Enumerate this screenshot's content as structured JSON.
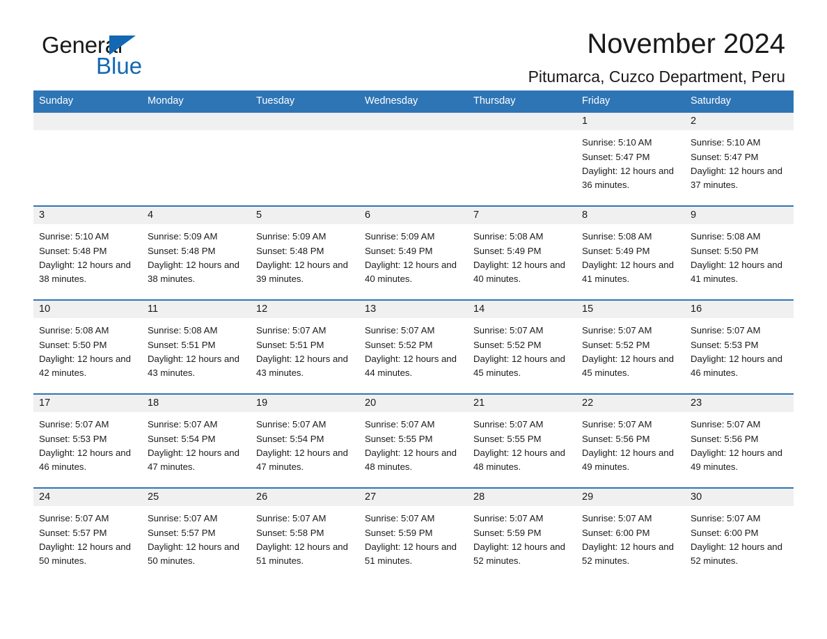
{
  "brand": {
    "name_part1": "General",
    "name_part2": "Blue",
    "accent_color": "#1268b3"
  },
  "header": {
    "title": "November 2024",
    "subtitle": "Pitumarca, Cuzco Department, Peru"
  },
  "calendar": {
    "header_bg": "#2e75b6",
    "daynum_bg": "#f0f0f0",
    "weekday_names": [
      "Sunday",
      "Monday",
      "Tuesday",
      "Wednesday",
      "Thursday",
      "Friday",
      "Saturday"
    ],
    "labels": {
      "sunrise": "Sunrise:",
      "sunset": "Sunset:",
      "daylight": "Daylight:"
    },
    "weeks": [
      [
        {
          "day": "",
          "empty": true
        },
        {
          "day": "",
          "empty": true
        },
        {
          "day": "",
          "empty": true
        },
        {
          "day": "",
          "empty": true
        },
        {
          "day": "",
          "empty": true
        },
        {
          "day": "1",
          "sunrise": "Sunrise: 5:10 AM",
          "sunset": "Sunset: 5:47 PM",
          "daylight": "Daylight: 12 hours and 36 minutes."
        },
        {
          "day": "2",
          "sunrise": "Sunrise: 5:10 AM",
          "sunset": "Sunset: 5:47 PM",
          "daylight": "Daylight: 12 hours and 37 minutes."
        }
      ],
      [
        {
          "day": "3",
          "sunrise": "Sunrise: 5:10 AM",
          "sunset": "Sunset: 5:48 PM",
          "daylight": "Daylight: 12 hours and 38 minutes."
        },
        {
          "day": "4",
          "sunrise": "Sunrise: 5:09 AM",
          "sunset": "Sunset: 5:48 PM",
          "daylight": "Daylight: 12 hours and 38 minutes."
        },
        {
          "day": "5",
          "sunrise": "Sunrise: 5:09 AM",
          "sunset": "Sunset: 5:48 PM",
          "daylight": "Daylight: 12 hours and 39 minutes."
        },
        {
          "day": "6",
          "sunrise": "Sunrise: 5:09 AM",
          "sunset": "Sunset: 5:49 PM",
          "daylight": "Daylight: 12 hours and 40 minutes."
        },
        {
          "day": "7",
          "sunrise": "Sunrise: 5:08 AM",
          "sunset": "Sunset: 5:49 PM",
          "daylight": "Daylight: 12 hours and 40 minutes."
        },
        {
          "day": "8",
          "sunrise": "Sunrise: 5:08 AM",
          "sunset": "Sunset: 5:49 PM",
          "daylight": "Daylight: 12 hours and 41 minutes."
        },
        {
          "day": "9",
          "sunrise": "Sunrise: 5:08 AM",
          "sunset": "Sunset: 5:50 PM",
          "daylight": "Daylight: 12 hours and 41 minutes."
        }
      ],
      [
        {
          "day": "10",
          "sunrise": "Sunrise: 5:08 AM",
          "sunset": "Sunset: 5:50 PM",
          "daylight": "Daylight: 12 hours and 42 minutes."
        },
        {
          "day": "11",
          "sunrise": "Sunrise: 5:08 AM",
          "sunset": "Sunset: 5:51 PM",
          "daylight": "Daylight: 12 hours and 43 minutes."
        },
        {
          "day": "12",
          "sunrise": "Sunrise: 5:07 AM",
          "sunset": "Sunset: 5:51 PM",
          "daylight": "Daylight: 12 hours and 43 minutes."
        },
        {
          "day": "13",
          "sunrise": "Sunrise: 5:07 AM",
          "sunset": "Sunset: 5:52 PM",
          "daylight": "Daylight: 12 hours and 44 minutes."
        },
        {
          "day": "14",
          "sunrise": "Sunrise: 5:07 AM",
          "sunset": "Sunset: 5:52 PM",
          "daylight": "Daylight: 12 hours and 45 minutes."
        },
        {
          "day": "15",
          "sunrise": "Sunrise: 5:07 AM",
          "sunset": "Sunset: 5:52 PM",
          "daylight": "Daylight: 12 hours and 45 minutes."
        },
        {
          "day": "16",
          "sunrise": "Sunrise: 5:07 AM",
          "sunset": "Sunset: 5:53 PM",
          "daylight": "Daylight: 12 hours and 46 minutes."
        }
      ],
      [
        {
          "day": "17",
          "sunrise": "Sunrise: 5:07 AM",
          "sunset": "Sunset: 5:53 PM",
          "daylight": "Daylight: 12 hours and 46 minutes."
        },
        {
          "day": "18",
          "sunrise": "Sunrise: 5:07 AM",
          "sunset": "Sunset: 5:54 PM",
          "daylight": "Daylight: 12 hours and 47 minutes."
        },
        {
          "day": "19",
          "sunrise": "Sunrise: 5:07 AM",
          "sunset": "Sunset: 5:54 PM",
          "daylight": "Daylight: 12 hours and 47 minutes."
        },
        {
          "day": "20",
          "sunrise": "Sunrise: 5:07 AM",
          "sunset": "Sunset: 5:55 PM",
          "daylight": "Daylight: 12 hours and 48 minutes."
        },
        {
          "day": "21",
          "sunrise": "Sunrise: 5:07 AM",
          "sunset": "Sunset: 5:55 PM",
          "daylight": "Daylight: 12 hours and 48 minutes."
        },
        {
          "day": "22",
          "sunrise": "Sunrise: 5:07 AM",
          "sunset": "Sunset: 5:56 PM",
          "daylight": "Daylight: 12 hours and 49 minutes."
        },
        {
          "day": "23",
          "sunrise": "Sunrise: 5:07 AM",
          "sunset": "Sunset: 5:56 PM",
          "daylight": "Daylight: 12 hours and 49 minutes."
        }
      ],
      [
        {
          "day": "24",
          "sunrise": "Sunrise: 5:07 AM",
          "sunset": "Sunset: 5:57 PM",
          "daylight": "Daylight: 12 hours and 50 minutes."
        },
        {
          "day": "25",
          "sunrise": "Sunrise: 5:07 AM",
          "sunset": "Sunset: 5:57 PM",
          "daylight": "Daylight: 12 hours and 50 minutes."
        },
        {
          "day": "26",
          "sunrise": "Sunrise: 5:07 AM",
          "sunset": "Sunset: 5:58 PM",
          "daylight": "Daylight: 12 hours and 51 minutes."
        },
        {
          "day": "27",
          "sunrise": "Sunrise: 5:07 AM",
          "sunset": "Sunset: 5:59 PM",
          "daylight": "Daylight: 12 hours and 51 minutes."
        },
        {
          "day": "28",
          "sunrise": "Sunrise: 5:07 AM",
          "sunset": "Sunset: 5:59 PM",
          "daylight": "Daylight: 12 hours and 52 minutes."
        },
        {
          "day": "29",
          "sunrise": "Sunrise: 5:07 AM",
          "sunset": "Sunset: 6:00 PM",
          "daylight": "Daylight: 12 hours and 52 minutes."
        },
        {
          "day": "30",
          "sunrise": "Sunrise: 5:07 AM",
          "sunset": "Sunset: 6:00 PM",
          "daylight": "Daylight: 12 hours and 52 minutes."
        }
      ]
    ]
  }
}
